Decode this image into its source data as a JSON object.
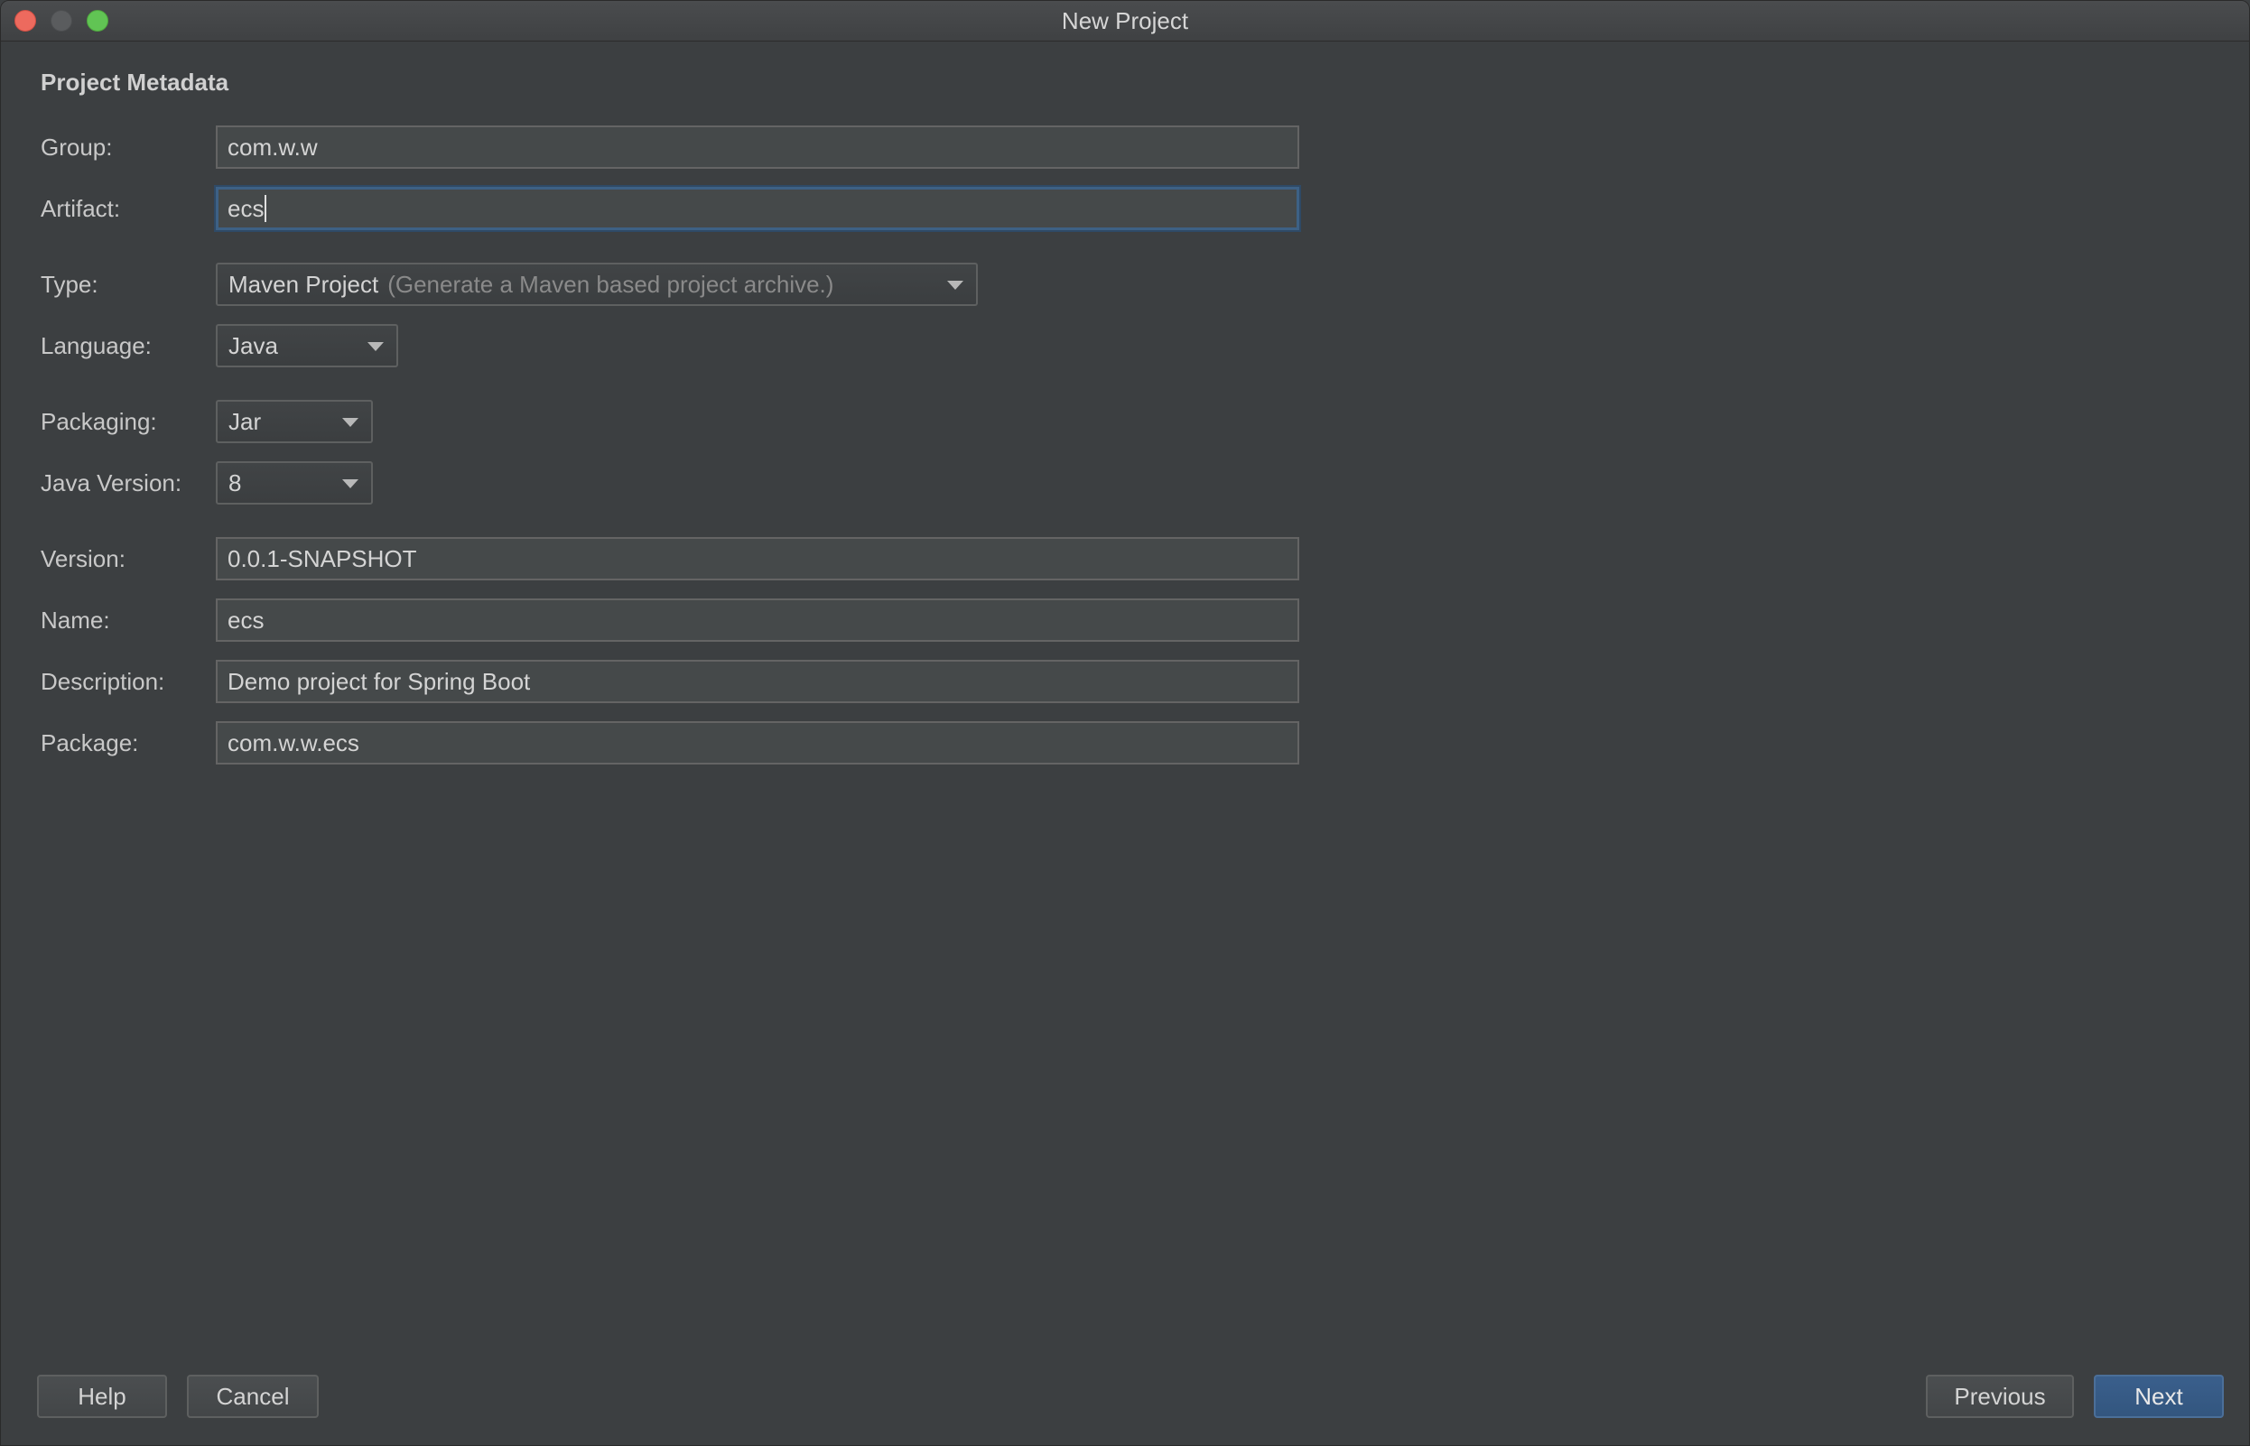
{
  "window": {
    "title": "New Project"
  },
  "section": {
    "title": "Project Metadata"
  },
  "fields": {
    "group": {
      "label": "Group:",
      "value": "com.w.w"
    },
    "artifact": {
      "label": "Artifact:",
      "value": "ecs"
    },
    "type": {
      "label": "Type:",
      "value": "Maven Project",
      "hint": "(Generate a Maven based project archive.)"
    },
    "language": {
      "label": "Language:",
      "value": "Java"
    },
    "packaging": {
      "label": "Packaging:",
      "value": "Jar"
    },
    "java_version": {
      "label": "Java Version:",
      "value": "8"
    },
    "version": {
      "label": "Version:",
      "value": "0.0.1-SNAPSHOT"
    },
    "name": {
      "label": "Name:",
      "value": "ecs"
    },
    "description": {
      "label": "Description:",
      "value": "Demo project for Spring Boot"
    },
    "package": {
      "label": "Package:",
      "value": "com.w.w.ecs"
    }
  },
  "buttons": {
    "help": "Help",
    "cancel": "Cancel",
    "previous": "Previous",
    "next": "Next"
  },
  "colors": {
    "background": "#3c3f41",
    "focus_border": "#3d6185",
    "primary_button": "#365a85"
  },
  "icons": {
    "close": "traffic-close-icon",
    "minimize": "traffic-minimize-icon",
    "maximize": "traffic-maximize-icon",
    "dropdown": "chevron-down-icon"
  }
}
